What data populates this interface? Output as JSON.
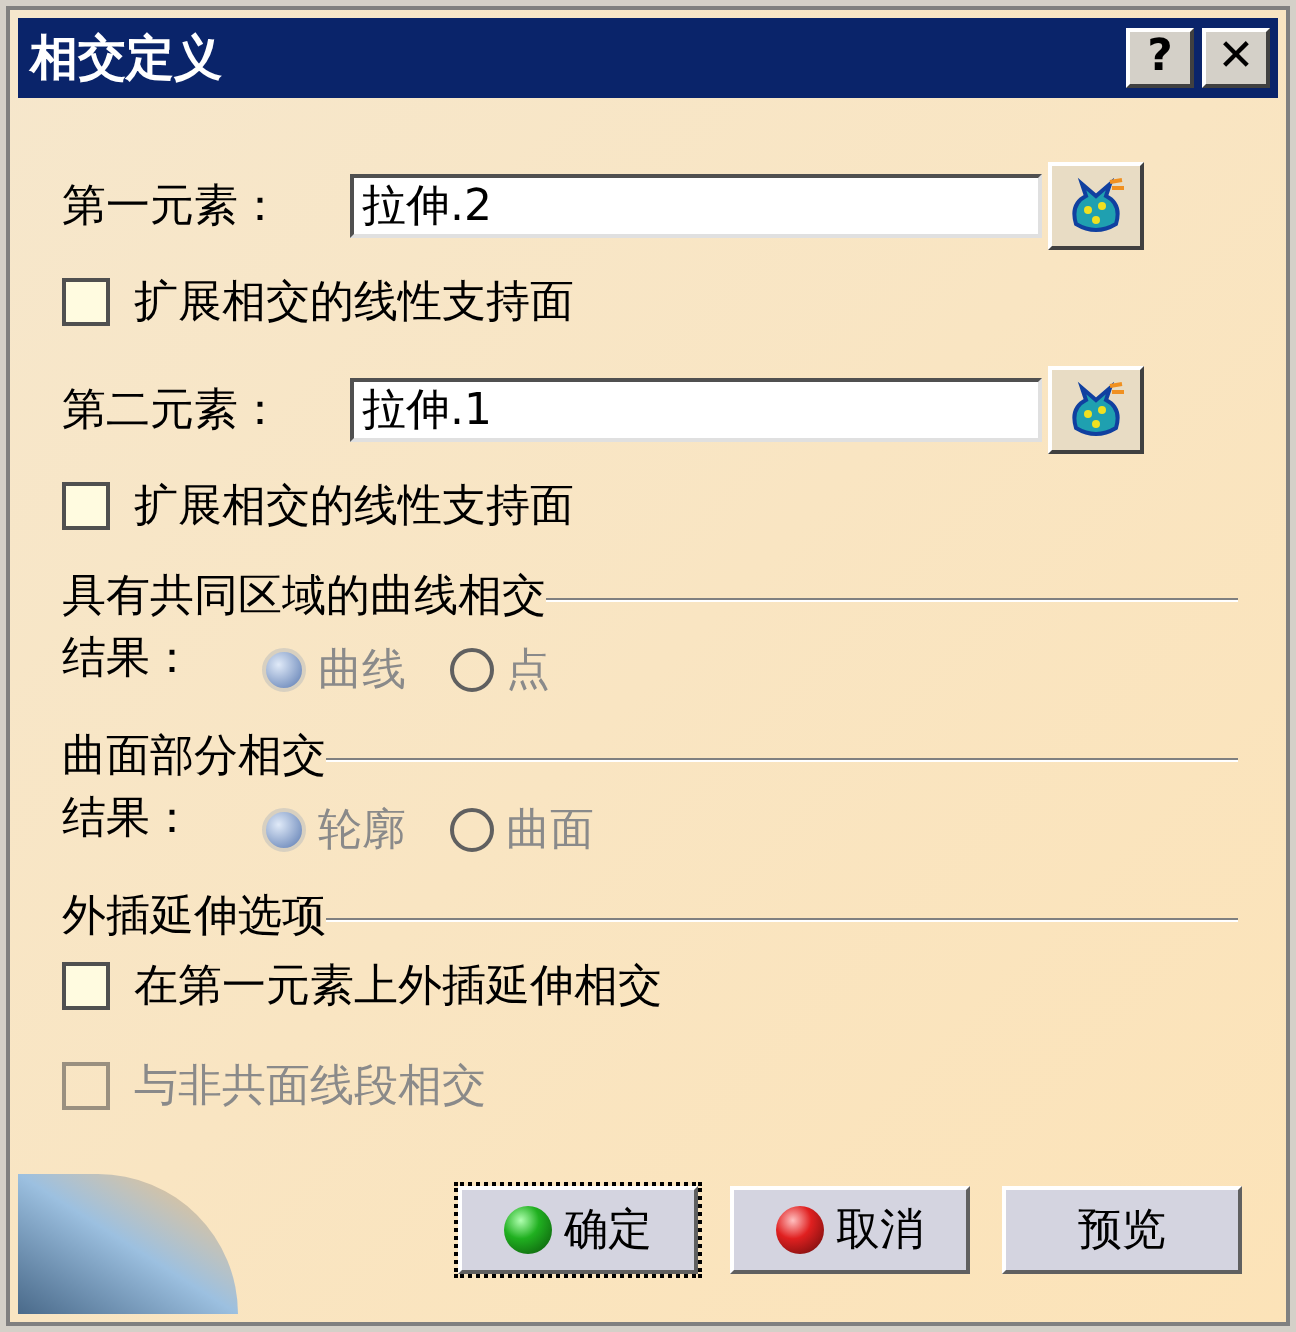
{
  "window": {
    "title": "相交定义",
    "title_buttons": [
      {
        "label": "?"
      },
      {
        "label": "✕"
      }
    ]
  },
  "rows": [
    {
      "kind": "field",
      "label": "第一元素：",
      "value": "拉伸.2"
    },
    {
      "kind": "checkbox",
      "label": "扩展相交的线性支持面",
      "checked": false,
      "disabled": false
    },
    {
      "kind": "field",
      "label": "第二元素：",
      "value": "拉伸.1"
    },
    {
      "kind": "checkbox",
      "label": "扩展相交的线性支持面",
      "checked": false,
      "disabled": false
    },
    {
      "kind": "group",
      "label": "具有共同区域的曲线相交"
    },
    {
      "kind": "radios",
      "label": "结果：",
      "options": [
        {
          "label": "曲线",
          "selected": true,
          "disabled": true
        },
        {
          "label": "点",
          "selected": false,
          "disabled": true
        }
      ]
    },
    {
      "kind": "group",
      "label": "曲面部分相交"
    },
    {
      "kind": "radios",
      "label": "结果：",
      "options": [
        {
          "label": "轮廓",
          "selected": true,
          "disabled": true
        },
        {
          "label": "曲面",
          "selected": false,
          "disabled": true
        }
      ]
    },
    {
      "kind": "group",
      "label": "外插延伸选项"
    },
    {
      "kind": "checkbox",
      "label": "在第一元素上外插延伸相交",
      "checked": false,
      "disabled": false
    },
    {
      "kind": "checkbox",
      "label": "与非共面线段相交",
      "checked": false,
      "disabled": true
    }
  ],
  "buttons": [
    {
      "kind": "ok",
      "label": "确定",
      "default": true
    },
    {
      "kind": "cancel",
      "label": "取消",
      "default": false
    },
    {
      "kind": "preview",
      "label": "预览",
      "default": false
    }
  ]
}
